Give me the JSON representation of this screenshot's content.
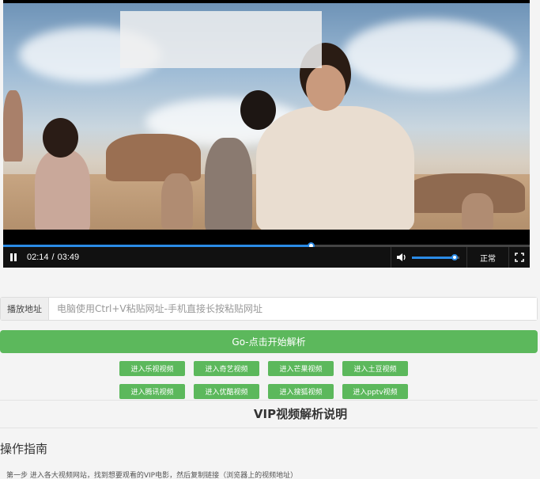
{
  "player": {
    "subtitle": "",
    "current_time": "02:14",
    "duration": "03:49",
    "progress_fraction": 0.585,
    "volume_fraction": 0.9,
    "speed_label": "正常",
    "icons": {
      "play": "pause-icon",
      "volume": "volume-icon",
      "fullscreen": "fullscreen-icon"
    }
  },
  "url_input": {
    "label": "播放地址",
    "placeholder": "电脑使用Ctrl+V粘贴网址-手机直接长按粘贴网址",
    "value": ""
  },
  "go_button": "Go-点击开始解析",
  "sites": [
    "进入乐视视频",
    "进入奇艺视频",
    "进入芒果视频",
    "进入土豆视频",
    "进入腾讯视频",
    "进入优酷视频",
    "进入搜狐视频",
    "进入pptv视频"
  ],
  "section_title": "VIP视频解析说明",
  "guide_title": "操作指南",
  "guide_text": "第一步 进入各大视频网站，找到想要观看的VIP电影，然后复制链接（浏览器上的视频地址）",
  "colors": {
    "accent_green": "#5cb85c",
    "progress_blue": "#2b8be6"
  }
}
